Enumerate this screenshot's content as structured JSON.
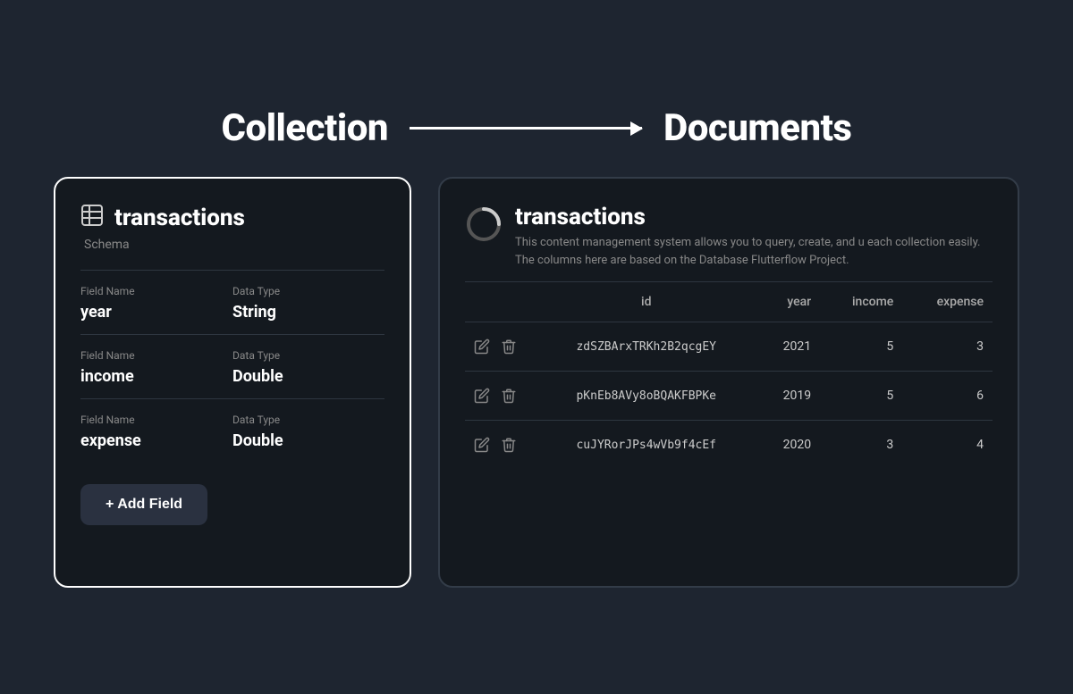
{
  "header": {
    "collection_label": "Collection",
    "documents_label": "Documents"
  },
  "left_card": {
    "icon": "⊞",
    "title": "transactions",
    "schema_label": "Schema",
    "fields": [
      {
        "field_name_label": "Field Name",
        "field_name": "year",
        "data_type_label": "Data Type",
        "data_type": "String"
      },
      {
        "field_name_label": "Field Name",
        "field_name": "income",
        "data_type_label": "Data Type",
        "data_type": "Double"
      },
      {
        "field_name_label": "Field Name",
        "field_name": "expense",
        "data_type_label": "Data Type",
        "data_type": "Double"
      }
    ],
    "add_field_label": "+ Add Field"
  },
  "right_card": {
    "title": "transactions",
    "description": "This content management system allows you to query, create, and u each collection easily. The columns here are based on the Database Flutterflow Project.",
    "columns": {
      "id": "id",
      "year": "year",
      "income": "income",
      "expense": "expense"
    },
    "rows": [
      {
        "id": "zdSZBArxTRKh2B2qcgEY",
        "year": "2021",
        "income": "5",
        "expense": "3"
      },
      {
        "id": "pKnEb8AVy8oBQAKFBPKe",
        "year": "2019",
        "income": "5",
        "expense": "6"
      },
      {
        "id": "cuJYRorJPs4wVb9f4cEf",
        "year": "2020",
        "income": "3",
        "expense": "4"
      }
    ]
  }
}
